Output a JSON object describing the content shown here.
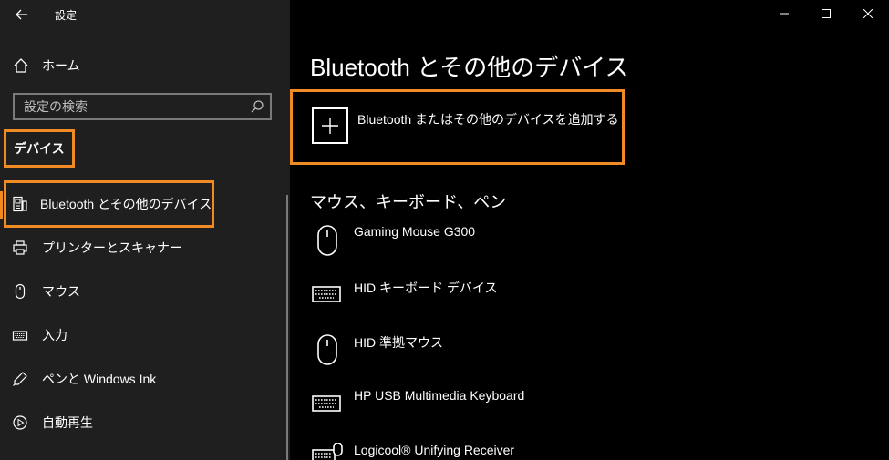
{
  "sidebar": {
    "title": "設定",
    "home_label": "ホーム",
    "search_placeholder": "設定の検索",
    "section_title": "デバイス",
    "items": [
      {
        "label": "Bluetooth とその他のデバイス",
        "icon": "bluetooth-device-icon",
        "active": true
      },
      {
        "label": "プリンターとスキャナー",
        "icon": "printer-icon"
      },
      {
        "label": "マウス",
        "icon": "mouse-icon"
      },
      {
        "label": "入力",
        "icon": "keyboard-icon"
      },
      {
        "label": "ペンと Windows Ink",
        "icon": "pen-icon"
      },
      {
        "label": "自動再生",
        "icon": "autoplay-icon"
      }
    ]
  },
  "window": {
    "minimize_icon": "minimize-icon",
    "maximize_icon": "maximize-icon",
    "close_icon": "close-icon"
  },
  "main": {
    "page_title": "Bluetooth とその他のデバイス",
    "add_device_label": "Bluetooth またはその他のデバイスを追加する",
    "group_title": "マウス、キーボード、ペン",
    "devices": [
      {
        "name": "Gaming Mouse G300",
        "icon": "mouse-icon"
      },
      {
        "name": "HID キーボード デバイス",
        "icon": "keyboard-icon"
      },
      {
        "name": "HID 準拠マウス",
        "icon": "mouse-icon"
      },
      {
        "name": "HP USB Multimedia Keyboard",
        "icon": "keyboard-icon"
      },
      {
        "name": "Logicool® Unifying Receiver",
        "icon": "keyboard-mouse-icon"
      }
    ]
  },
  "colors": {
    "highlight": "#f08a24",
    "sidebar_bg": "#1f1f1f",
    "main_bg": "#000000"
  }
}
